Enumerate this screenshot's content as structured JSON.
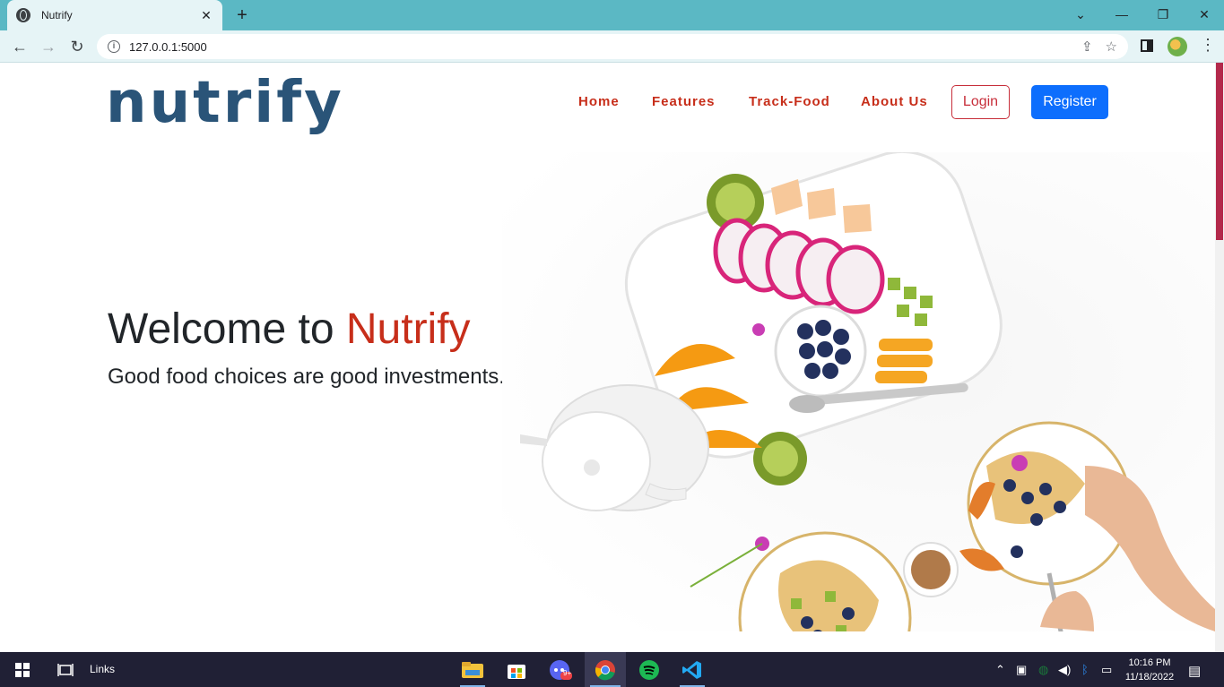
{
  "browser": {
    "tab_title": "Nutrify",
    "url": "127.0.0.1:5000",
    "new_tab": "+",
    "close_tab": "✕",
    "window_controls": [
      "⌄",
      "—",
      "❐",
      "✕"
    ]
  },
  "site": {
    "logo": "nutrify",
    "nav": [
      "Home",
      "Features",
      "Track-Food",
      "About Us"
    ],
    "login_label": "Login",
    "register_label": "Register",
    "hero_welcome": "Welcome to ",
    "hero_brand": "Nutrify",
    "hero_subtitle": "Good food choices are good investments."
  },
  "taskbar": {
    "links_label": "Links",
    "time": "10:16 PM",
    "date": "11/18/2022",
    "discord_badge": "9+"
  },
  "colors": {
    "logo": "#2a5478",
    "nav": "#c72e1a",
    "register_bg": "#0d6efd",
    "tabbar": "#5bb8c4",
    "scroll_thumb": "#b3294b"
  }
}
